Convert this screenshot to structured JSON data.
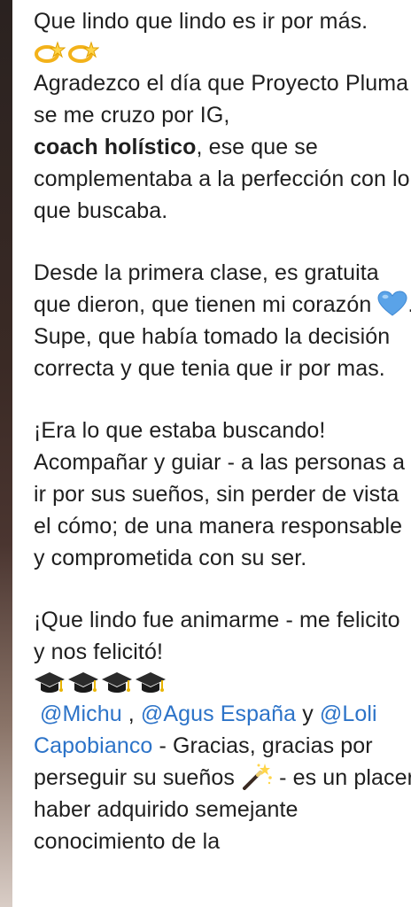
{
  "message": {
    "line1": "Que lindo que lindo es ir por más.",
    "emoji_row1": [
      "dizzy-icon",
      "dizzy-icon"
    ],
    "p2_a": "Agradezco el día que Proyecto Pluma se me cruzo por IG,",
    "p2_bold": "coach holístico",
    "p2_b": ", ese que se complementaba a la perfección con lo que buscaba.",
    "p3_a": "Desde la primera clase, es gratuita que dieron, que tienen mi corazón",
    "p3_b": ". Supe, que había tomado la decisión correcta y que tenia que ir por mas.",
    "p4_1": "¡Era lo que estaba buscando!",
    "p4_2": "Acompañar y guiar - a las personas a ir por sus sueños, sin perder de vista el cómo; de una manera responsable y comprometida con su ser.",
    "p5": "¡Que lindo fue animarme - me felicito y nos felicitó!",
    "emoji_row2": [
      "graduation-cap-icon",
      "graduation-cap-icon",
      "graduation-cap-icon",
      "graduation-cap-icon"
    ],
    "mention1": "@Michu",
    "sep1": " , ",
    "mention2": "@Agus España",
    "sep2": " y ",
    "mention3": "@Loli Capobianco",
    "p6_a": " - Gracias, gracias por perseguir su sueños",
    "p6_b": " - es un placer haber adquirido semejante conocimiento de la"
  },
  "colors": {
    "text": "#1f1f1f",
    "mention": "#2c73c8",
    "background": "#ffffff"
  }
}
